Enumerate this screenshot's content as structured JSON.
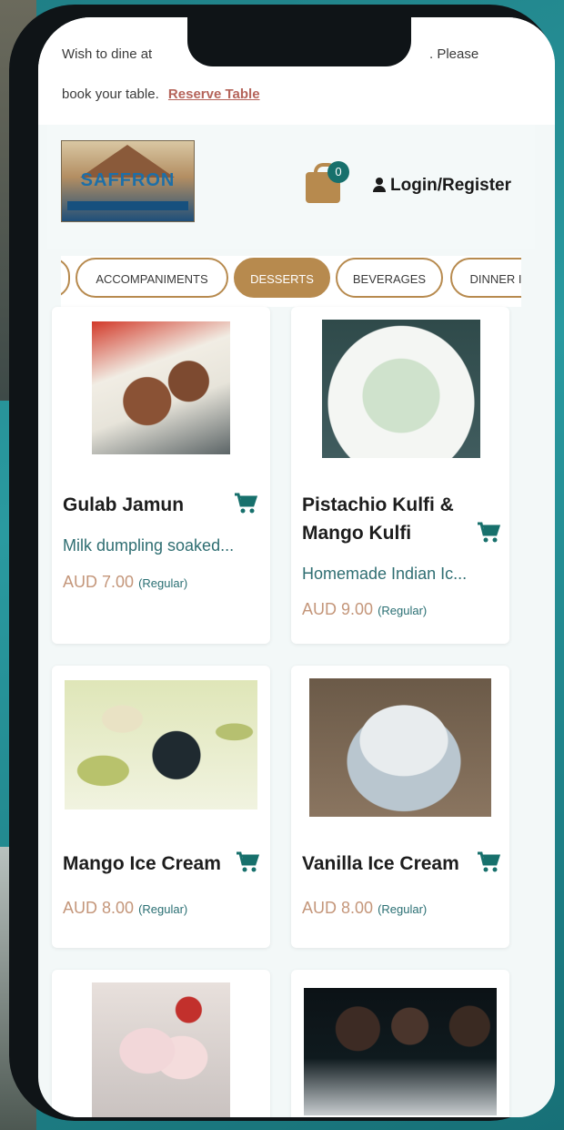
{
  "announcement": {
    "line1_left": "Wish to dine at",
    "line1_right": ". Please",
    "line2": "book your table.",
    "reserve_link": "Reserve Table"
  },
  "header": {
    "logo_alt": "SAFFRON",
    "cart_count": "0",
    "login_label": "Login/Register"
  },
  "categories": {
    "items": [
      "ACCOMPANIMENTS",
      "DESSERTS",
      "BEVERAGES",
      "DINNER I"
    ],
    "active": "DESSERTS"
  },
  "products": [
    {
      "name": "Gulab Jamun",
      "description": "Milk dumpling soaked...",
      "price": "AUD 7.00",
      "variant": "(Regular)"
    },
    {
      "name": "Pistachio Kulfi &",
      "name2": "Mango Kulfi",
      "description": "Homemade Indian Ic...",
      "price": "AUD 9.00",
      "variant": "(Regular)"
    },
    {
      "name": "Mango Ice Cream",
      "price": "AUD 8.00",
      "variant": "(Regular)"
    },
    {
      "name": "Vanilla Ice Cream",
      "price": "AUD 8.00",
      "variant": "(Regular)"
    }
  ],
  "colors": {
    "accent": "#b78a4e",
    "teal": "#17706c",
    "price": "#c4967a",
    "background": "#f3f8f8"
  },
  "icons": [
    "cart-icon",
    "user-icon",
    "add-to-cart-icon"
  ]
}
